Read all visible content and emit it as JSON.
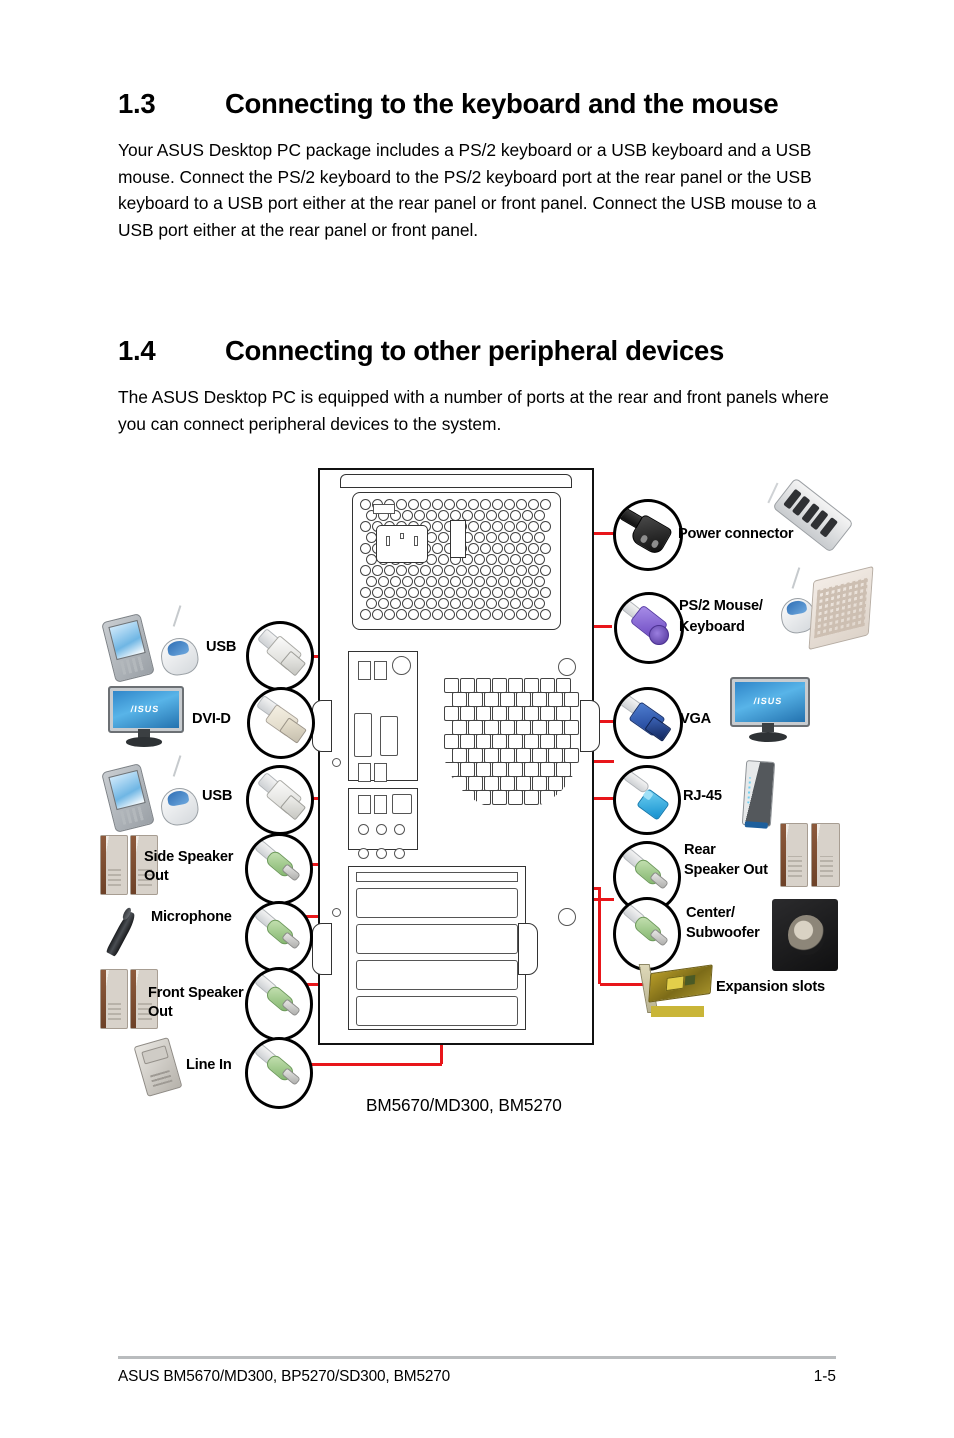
{
  "sections": [
    {
      "number": "1.3",
      "title": "Connecting to the keyboard and the mouse",
      "body": "Your ASUS Desktop PC package includes a PS/2 keyboard or a USB keyboard and a USB mouse. Connect the PS/2 keyboard to the PS/2 keyboard port at the rear panel or the USB keyboard to a USB port either at the rear panel or front panel. Connect the USB mouse to a USB port either at the rear panel or front panel."
    },
    {
      "number": "1.4",
      "title": "Connecting to other peripheral devices",
      "body": "The ASUS Desktop PC is equipped with a number of ports at the rear and front panels where you can connect peripheral devices to the system."
    }
  ],
  "diagram": {
    "caption": "BM5670/MD300, BM5270",
    "left_callouts": [
      {
        "label": "USB",
        "connector": "usb-connector",
        "device": "pda-and-mouse"
      },
      {
        "label": "DVI-D",
        "connector": "dvi-connector",
        "device": "lcd-monitor"
      },
      {
        "label": "USB",
        "connector": "usb-connector",
        "device": "pda-and-mouse"
      },
      {
        "label": "Side Speaker Out",
        "connector": "audio-jack-green",
        "device": "stereo-speakers"
      },
      {
        "label": "Microphone",
        "connector": "audio-jack-green",
        "device": "microphone"
      },
      {
        "label": "Front Speaker Out",
        "connector": "audio-jack-green",
        "device": "stereo-speakers"
      },
      {
        "label": "Line In",
        "connector": "audio-jack-green",
        "device": "audio-recorder"
      }
    ],
    "right_callouts": [
      {
        "label": "Power connector",
        "connector": "power-cord-connector",
        "device": "power-strip"
      },
      {
        "label": "PS/2 Mouse/ Keyboard",
        "label_line1": "PS/2 Mouse/",
        "label_line2": "Keyboard",
        "connector": "ps2-connector",
        "device": "mouse-and-keyboard"
      },
      {
        "label": "VGA",
        "connector": "vga-connector",
        "device": "lcd-monitor"
      },
      {
        "label": "RJ-45",
        "connector": "rj45-connector",
        "device": "network-router"
      },
      {
        "label": "Rear Speaker Out",
        "label_line1": "Rear",
        "label_line2": "Speaker Out",
        "connector": "audio-jack-green",
        "device": "stereo-speakers"
      },
      {
        "label": "Center/ Subwoofer",
        "label_line1": "Center/",
        "label_line2": "Subwoofer",
        "connector": "audio-jack-green",
        "device": "subwoofer"
      },
      {
        "label": "Expansion slots",
        "connector": "none",
        "device": "expansion-card"
      }
    ],
    "colors": {
      "callout_line": "#e8161a",
      "ps2_connector": "#7b56c9",
      "vga_connector": "#2352a8",
      "rj45_connector": "#1e9ad6",
      "audio_jack": "#9ec98b",
      "power_connector": "#1a1a1a",
      "dvi_connector": "#e9e4d8"
    }
  },
  "footer": {
    "left": "ASUS BM5670/MD300, BP5270/SD300, BM5270",
    "page": "1-5"
  }
}
